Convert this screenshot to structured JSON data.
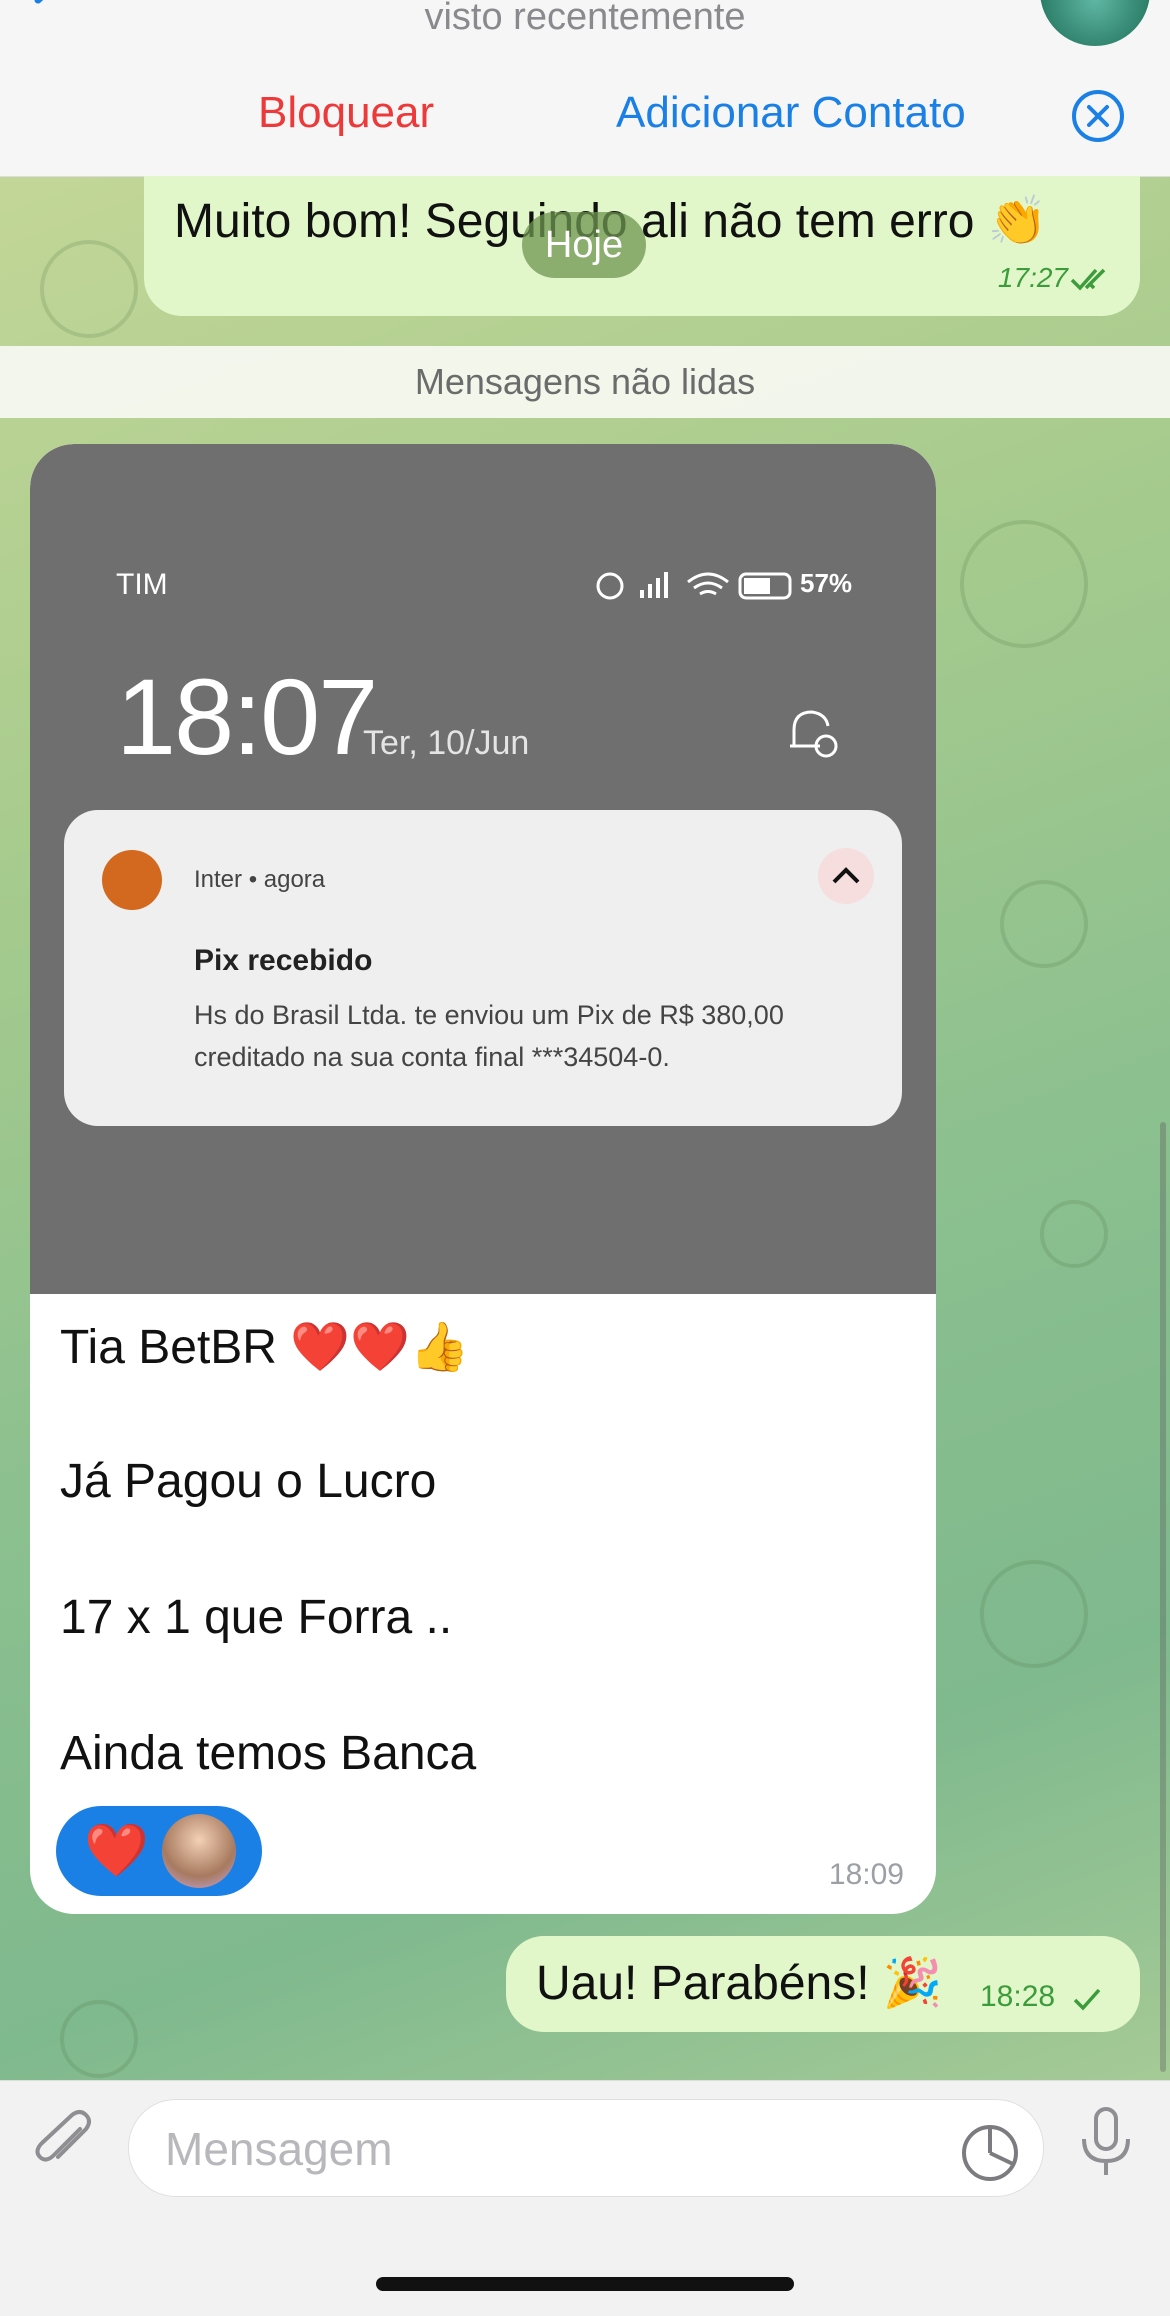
{
  "header": {
    "subtitle": "visto recentemente"
  },
  "action_bar": {
    "block_label": "Bloquear",
    "add_contact_label": "Adicionar Contato"
  },
  "messages": {
    "m1": {
      "text": "Muito bom! Seguindo ali não tem erro 👏",
      "time": "17:27",
      "status": "read"
    },
    "date_pill": "Hoje",
    "unread_divider": "Mensagens não lidas",
    "m2": {
      "screenshot": {
        "carrier": "TIM",
        "battery": "57%",
        "clock": "18:07",
        "date": "Ter, 10/Jun",
        "notification": {
          "app": "Inter • agora",
          "title": "Pix recebido",
          "line1": "Hs do Brasil Ltda. te enviou um Pix de R$ 380,00",
          "line2": "creditado na sua conta final ***34504-0."
        }
      },
      "caption_lines": [
        "Tia BetBR ❤️❤️👍",
        "Já Pagou o Lucro",
        "17 x 1 que Forra ..",
        "Ainda temos Banca"
      ],
      "reaction": "❤️",
      "time": "18:09"
    },
    "m3": {
      "text": "Uau! Parabéns! 🎉",
      "time": "18:28",
      "status": "delivered"
    }
  },
  "composer": {
    "placeholder": "Mensagem"
  },
  "colors": {
    "outgoing_bubble": "#e1f7c9",
    "accent_blue": "#1a80e6",
    "block_red": "#ec3a3a"
  }
}
